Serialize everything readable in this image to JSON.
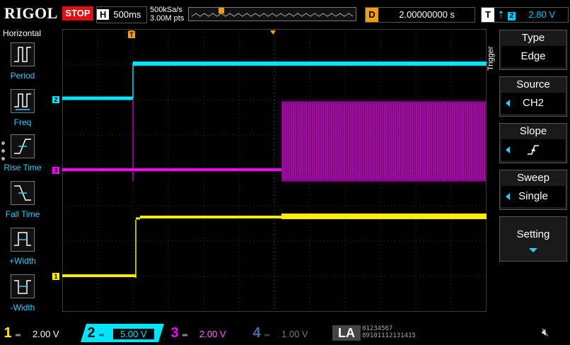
{
  "topbar": {
    "logo": "RIGOL",
    "status": "STOP",
    "timebase_key": "H",
    "timebase": "500ms",
    "sample_rate": "500kSa/s",
    "memory_depth": "3.00M pts",
    "delay_key": "D",
    "delay": "2.00000000 s",
    "trigger_key": "T",
    "trigger_edge": "⨍",
    "trigger_channel": "2",
    "trigger_level": "2.80 V"
  },
  "leftmenu": {
    "title": "Horizontal",
    "items": [
      {
        "label": "Period"
      },
      {
        "label": "Freq"
      },
      {
        "label": "Rise Time"
      },
      {
        "label": "Fall Time"
      },
      {
        "label": "+Width"
      },
      {
        "label": "-Width"
      }
    ]
  },
  "rightmenu": {
    "side_title": "Trigger",
    "type_label": "Type",
    "type_value": "Edge",
    "source_label": "Source",
    "source_value": "CH2",
    "slope_label": "Slope",
    "sweep_label": "Sweep",
    "sweep_value": "Single",
    "setting_label": "Setting"
  },
  "channels": [
    {
      "num": "1",
      "scale": "2.00 V",
      "color": "#ffee00"
    },
    {
      "num": "2",
      "scale": "5.00 V",
      "color": "#00e5ff"
    },
    {
      "num": "3",
      "scale": "2.00 V",
      "color": "#ff00ff"
    },
    {
      "num": "4",
      "scale": "1.00 V",
      "color": "#4a6aa0"
    }
  ],
  "bottombar": {
    "la_label": "LA"
  },
  "icons": {
    "speaker": "speaker-muted-icon"
  }
}
